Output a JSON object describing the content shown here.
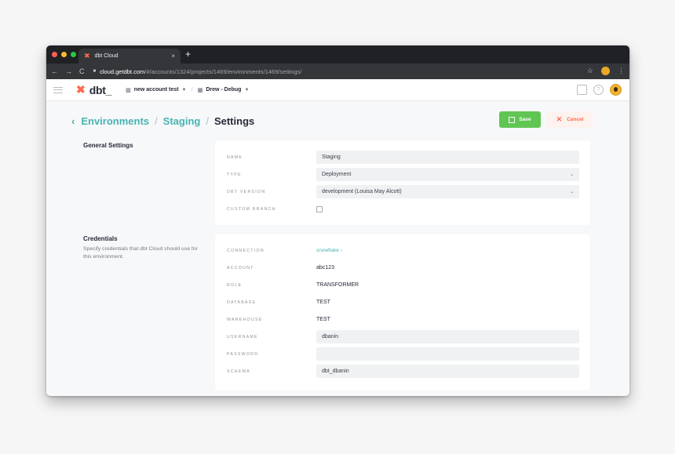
{
  "browser": {
    "tab_title": "dbt Cloud",
    "tab_close": "×",
    "new_tab": "+",
    "url_host": "cloud.getdbt.com",
    "url_path": "/#/accounts/1324/projects/1469/environments/1469/settings/",
    "back_glyph": "←",
    "forward_glyph": "→",
    "reload_glyph": "C",
    "star_glyph": "☆",
    "menu_glyph": "⋮",
    "traffic_lights": [
      "#ff5f57",
      "#febc2e",
      "#28c840"
    ]
  },
  "header": {
    "logo_text": "dbt_",
    "logo_mark": "✖",
    "account_label": "new account test",
    "project_label": "Drew - Debug",
    "brand_color": "#ff694b"
  },
  "breadcrumb": {
    "back_glyph": "‹",
    "items": [
      "Environments",
      "Staging"
    ],
    "separator": "/",
    "current": "Settings",
    "link_color": "#47b3b3"
  },
  "actions": {
    "save_label": "Save",
    "cancel_label": "Cancel",
    "save_color": "#61c554",
    "cancel_color": "#ff694b"
  },
  "general": {
    "title": "General Settings",
    "fields": {
      "name": {
        "label": "NAME",
        "value": "Staging"
      },
      "type": {
        "label": "TYPE",
        "value": "Deployment"
      },
      "dbt_version": {
        "label": "DBT VERSION",
        "value": "development (Louisa May Alcott)"
      },
      "custom_branch": {
        "label": "CUSTOM BRANCH",
        "checked": false
      }
    }
  },
  "credentials": {
    "title": "Credentials",
    "description": "Specify credentials that dbt Cloud should use for this environment.",
    "fields": {
      "connection": {
        "label": "CONNECTION",
        "value": "snowflake ›"
      },
      "account": {
        "label": "ACCOUNT",
        "value": "abc123"
      },
      "role": {
        "label": "ROLE",
        "value": "TRANSFORMER"
      },
      "database": {
        "label": "DATABASE",
        "value": "TEST"
      },
      "warehouse": {
        "label": "WAREHOUSE",
        "value": "TEST"
      },
      "username": {
        "label": "USERNAME",
        "value": "dbanin"
      },
      "password": {
        "label": "PASSWORD",
        "value": ""
      },
      "schema": {
        "label": "SCHEMA",
        "value": "dbt_dbanin"
      }
    }
  }
}
